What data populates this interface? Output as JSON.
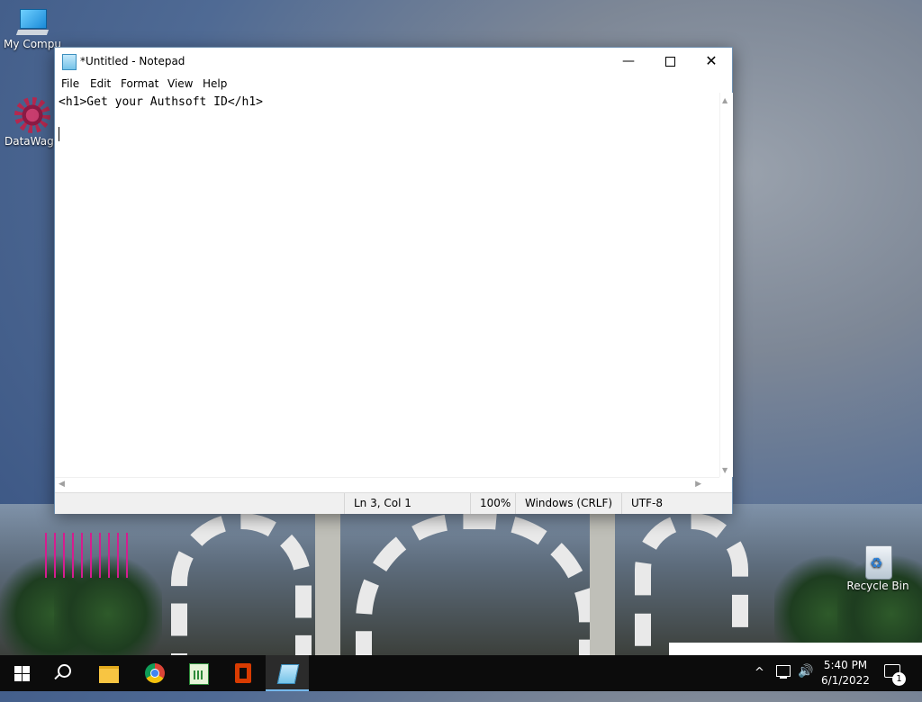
{
  "desktop": {
    "icons": [
      {
        "label": "My Compu"
      },
      {
        "label": "DataWago"
      },
      {
        "label": "Recycle Bin"
      }
    ]
  },
  "notepad": {
    "title": "*Untitled - Notepad",
    "menu": [
      "File",
      "Edit",
      "Format",
      "View",
      "Help"
    ],
    "content_line1": "<h1>Get your Authsoft ID</h1>",
    "status": {
      "position": "Ln 3, Col 1",
      "zoom": "100%",
      "line_ending": "Windows (CRLF)",
      "encoding": "UTF-8"
    },
    "window_controls": {
      "minimize": "—",
      "close": "✕"
    }
  },
  "taskbar": {
    "apps": [
      "start-icon",
      "search-icon",
      "file-explorer-icon",
      "chrome-icon",
      "sheet-app-icon",
      "office-icon",
      "notepad-icon"
    ],
    "clock": {
      "time": "5:40 PM",
      "date": "6/1/2022"
    },
    "notification_count": "1",
    "tray": {
      "chevron": "^",
      "volume": "🔊"
    }
  },
  "colors": {
    "taskbar": "#0c0c0c",
    "accent": "#76b9ed"
  }
}
